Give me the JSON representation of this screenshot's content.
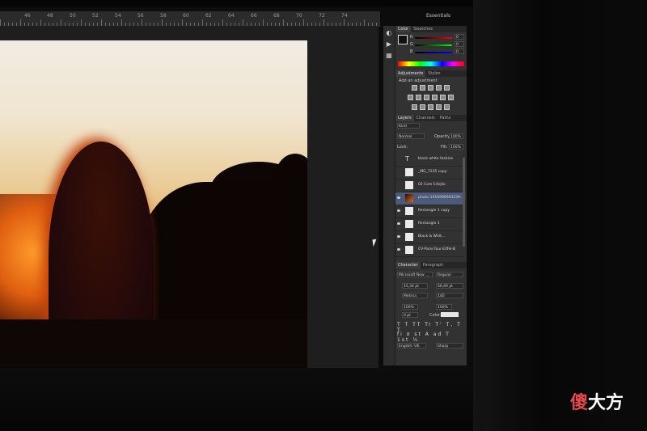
{
  "app": {
    "workspace_label": "Essentials"
  },
  "ruler": {
    "numbers": [
      "46",
      "48",
      "50",
      "52",
      "54",
      "56",
      "58",
      "60",
      "62",
      "64",
      "66",
      "68",
      "70",
      "72",
      "74"
    ]
  },
  "color_panel": {
    "tabs": [
      "Color",
      "Swatches"
    ],
    "channels": [
      "R",
      "G",
      "B"
    ],
    "values": [
      "0",
      "0",
      "0"
    ]
  },
  "adjustments_panel": {
    "tabs": [
      "Adjustments",
      "Styles"
    ],
    "heading": "Add an adjustment"
  },
  "layers_panel": {
    "tabs": [
      "Layers",
      "Channels",
      "Paths"
    ],
    "filter_label": "Kind",
    "blend_mode": "Normal",
    "opacity_label": "Opacity:",
    "opacity_value": "100%",
    "lock_label": "Lock:",
    "fill_label": "Fill:",
    "fill_value": "100%",
    "layers": [
      {
        "name": "black white fashion",
        "visible": false,
        "type": "text"
      },
      {
        "name": "_MG_7235 copy",
        "visible": false,
        "type": "image"
      },
      {
        "name": "02 Com Edição",
        "visible": false,
        "type": "image"
      },
      {
        "name": "photo-1416996003239-...",
        "visible": true,
        "type": "image",
        "selected": true
      },
      {
        "name": "Rectangle 1 copy",
        "visible": true,
        "type": "shape"
      },
      {
        "name": "Rectangle 1",
        "visible": true,
        "type": "shape"
      },
      {
        "name": "Black & Whit...",
        "visible": true,
        "type": "adjustment"
      },
      {
        "name": "CV-Paris-Tour-Eiffel-B",
        "visible": true,
        "type": "image"
      }
    ]
  },
  "character_panel": {
    "tabs": [
      "Character",
      "Paragraph"
    ],
    "font_family": "Microsoft New ...",
    "font_style": "Regular",
    "font_size": "15,34 pt",
    "leading": "46,49 pt",
    "kerning": "Metrics",
    "tracking": "140",
    "vertical_scale": "100%",
    "horizontal_scale": "100%",
    "baseline_shift": "0 pt",
    "color_label": "Color:",
    "language": "English: UK",
    "antialias": "Sharp"
  },
  "watermark": {
    "part1": "傻",
    "part2": "大方"
  },
  "colors": {
    "panel_bg": "#323232",
    "selected_layer": "#4a5a78",
    "watermark_red": "#e54a4a"
  }
}
